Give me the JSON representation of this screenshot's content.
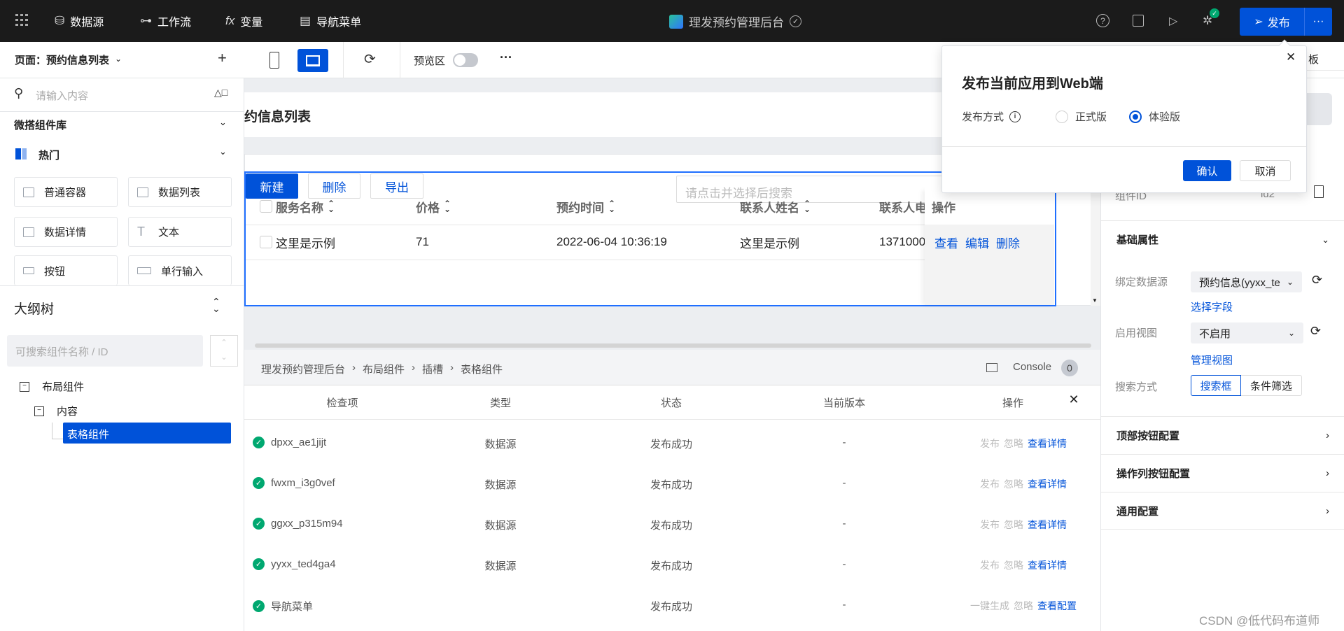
{
  "header": {
    "menu_items": [
      {
        "label": "数据源",
        "icon": "database-icon"
      },
      {
        "label": "工作流",
        "icon": "workflow-icon"
      },
      {
        "label": "变量",
        "icon": "fx-icon"
      },
      {
        "label": "导航菜单",
        "icon": "nav-menu-icon"
      }
    ],
    "app_title": "理发预约管理后台",
    "publish_label": "发布",
    "publish_more": "···",
    "brand_color": "#0052d9"
  },
  "toolbar": {
    "page_label": "页面：预约信息列表",
    "preview_label": "预览区",
    "more": "···",
    "preview_enabled": false
  },
  "left": {
    "search_placeholder": "请输入内容",
    "library_title": "微搭组件库",
    "category": "热门",
    "components": [
      "普通容器",
      "数据列表",
      "数据详情",
      "文本",
      "按钮",
      "单行输入"
    ],
    "outline_title": "大纲树",
    "outline_search_placeholder": "可搜索组件名称 / ID",
    "tree": [
      "布局组件",
      "内容",
      "表格组件"
    ]
  },
  "canvas": {
    "page_title": "约信息列表",
    "buttons": [
      "新建",
      "删除",
      "导出"
    ],
    "search_placeholder": "请点击并选择后搜索",
    "columns": [
      "服务名称",
      "价格",
      "预约时间",
      "联系人姓名",
      "联系人电"
    ],
    "action_column": "操作",
    "row": {
      "values": [
        "这里是示例",
        "71",
        "2022-06-04 10:36:19",
        "这里是示例",
        "1371000"
      ],
      "actions": [
        "查看",
        "编辑",
        "删除"
      ]
    }
  },
  "bottom": {
    "breadcrumb": [
      "理发预约管理后台",
      "布局组件",
      "插槽",
      "表格组件"
    ],
    "console_label": "Console",
    "console_count": "0",
    "columns": [
      "检查项",
      "类型",
      "状态",
      "当前版本",
      "操作"
    ],
    "rows": [
      {
        "name": "dpxx_ae1jijt",
        "type": "数据源",
        "status": "发布成功",
        "version": "-",
        "actions": [
          "发布",
          "忽略",
          "查看详情"
        ]
      },
      {
        "name": "fwxm_i3g0vef",
        "type": "数据源",
        "status": "发布成功",
        "version": "-",
        "actions": [
          "发布",
          "忽略",
          "查看详情"
        ]
      },
      {
        "name": "ggxx_p315m94",
        "type": "数据源",
        "status": "发布成功",
        "version": "-",
        "actions": [
          "发布",
          "忽略",
          "查看详情"
        ]
      },
      {
        "name": "yyxx_ted4ga4",
        "type": "数据源",
        "status": "发布成功",
        "version": "-",
        "actions": [
          "发布",
          "忽略",
          "查看详情"
        ]
      },
      {
        "name": "导航菜单",
        "type": "",
        "status": "发布成功",
        "version": "-",
        "actions": [
          "一键生成",
          "忽略",
          "查看配置"
        ]
      }
    ]
  },
  "right": {
    "partial_tab": "板",
    "component_id_label": "组件ID",
    "component_id": "id2",
    "basic_title": "基础属性",
    "datasource_label": "绑定数据源",
    "datasource_value": "预约信息(yyxx_te",
    "select_fields": "选择字段",
    "view_label": "启用视图",
    "view_value": "不启用",
    "manage_view": "管理视图",
    "search_label": "搜索方式",
    "search_options": [
      "搜索框",
      "条件筛选"
    ],
    "sections": [
      "顶部按钮配置",
      "操作列按钮配置",
      "通用配置"
    ]
  },
  "popover": {
    "title": "发布当前应用到Web端",
    "method_label": "发布方式",
    "options": [
      "正式版",
      "体验版"
    ],
    "selected": "体验版",
    "confirm": "确认",
    "cancel": "取消"
  },
  "watermark": "CSDN @低代码布道师"
}
